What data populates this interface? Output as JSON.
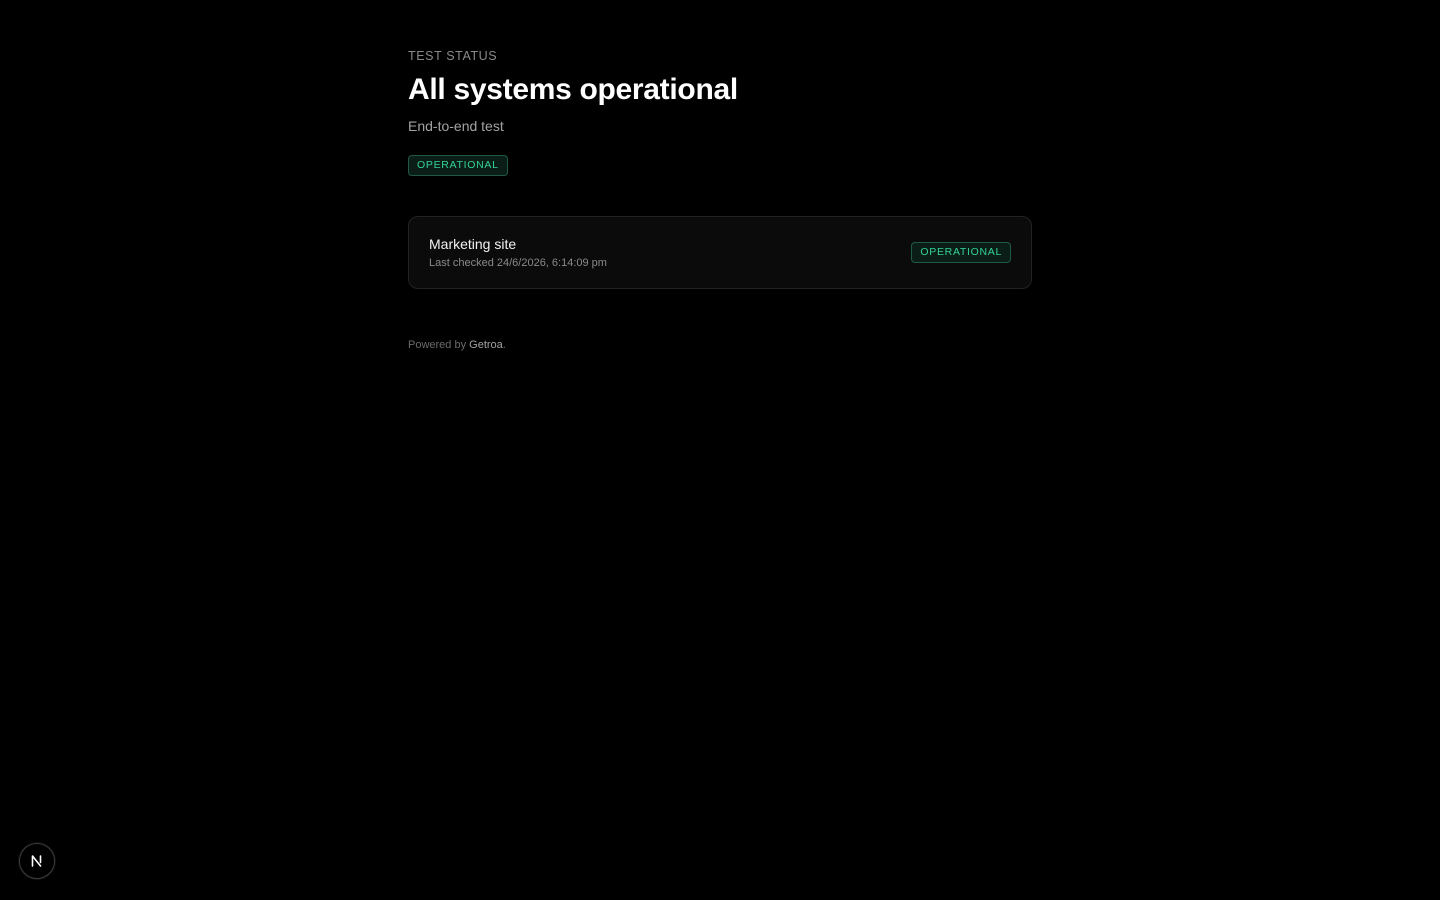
{
  "header": {
    "eyebrow": "TEST STATUS",
    "title": "All systems operational",
    "subtitle": "End-to-end test",
    "status_badge": "OPERATIONAL"
  },
  "services": [
    {
      "name": "Marketing site",
      "last_checked": "Last checked 24/6/2026, 6:14:09 pm",
      "status": "OPERATIONAL"
    }
  ],
  "footer": {
    "prefix": "Powered by ",
    "brand": "Getroa",
    "suffix": "."
  },
  "dev_indicator": {
    "icon": "nextjs-logo-icon"
  },
  "colors": {
    "background": "#000000",
    "status_green": "#34d399",
    "card_border": "#222222"
  }
}
